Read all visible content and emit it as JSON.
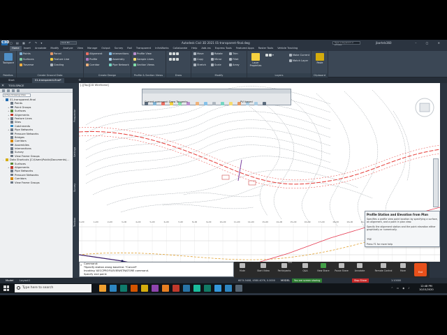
{
  "app": {
    "title": "Autodesk Civil 3D 2021   01-transparent-final.dwg",
    "search_placeholder": "Type a keyword or phrase",
    "user": "jbartels360",
    "workspace": "Civil 3D",
    "logo": "C3D"
  },
  "ribbon_tabs": [
    "Home",
    "Insert",
    "Annotate",
    "Modify",
    "Analyze",
    "View",
    "Manage",
    "Output",
    "Survey",
    "Rail",
    "Transparent",
    "InfraWorks",
    "Collaborate",
    "Help",
    "Add-ins",
    "Express Tools",
    "Featured Apps",
    "Raster Tools",
    "Vehicle Tracking"
  ],
  "active_tab": "Home",
  "ribbon": {
    "palettes": {
      "label": "Palettes",
      "button": "Toolspace"
    },
    "ground_data": {
      "label": "Create Ground Data",
      "items": [
        "Points",
        "Surfaces",
        "Traverse",
        "Parcel",
        "Feature Line",
        "Grading"
      ]
    },
    "design": {
      "label": "Create Design",
      "items": [
        "Alignment",
        "Profile",
        "Corridor",
        "Intersections",
        "Assembly",
        "Pipe Network"
      ]
    },
    "profile_section": {
      "label": "Profile & Section Views",
      "items": [
        "Profile View",
        "Sample Lines",
        "Section Views"
      ]
    },
    "draw": {
      "label": "Draw"
    },
    "modify": {
      "label": "Modify",
      "items": [
        "Move",
        "Copy",
        "Stretch",
        "Rotate",
        "Mirror",
        "Scale",
        "Trim",
        "Fillet",
        "Array"
      ]
    },
    "layers": {
      "label": "Layers",
      "button": "Layer Properties",
      "items": [
        "Make Current",
        "Match Layer"
      ]
    },
    "clipboard": {
      "label": "Clipboard",
      "button": "Paste"
    }
  },
  "doc_tabs": [
    "Start",
    "01-transparent-final*"
  ],
  "toolspace": {
    "title": "TOOLSPACE",
    "view_select": "Active Drawing View",
    "side_tabs": [
      "Prospector",
      "Settings",
      "Survey",
      "Toolbox"
    ],
    "tree": [
      {
        "label": "01-transparent-final",
        "level": 0,
        "icon_color": "#1f6ab0",
        "expand": "-"
      },
      {
        "label": "Points",
        "level": 1,
        "icon_color": "#6b7785",
        "expand": ""
      },
      {
        "label": "Point Groups",
        "level": 1,
        "icon_color": "#6b7785",
        "expand": "+"
      },
      {
        "label": "Surfaces",
        "level": 1,
        "icon_color": "#5a8a3a",
        "expand": "+"
      },
      {
        "label": "Alignments",
        "level": 1,
        "icon_color": "#c0392b",
        "expand": "+"
      },
      {
        "label": "Feature Lines",
        "level": 1,
        "icon_color": "#6b7785",
        "expand": "+"
      },
      {
        "label": "Sites",
        "level": 1,
        "icon_color": "#6b7785",
        "expand": ""
      },
      {
        "label": "Catchments",
        "level": 1,
        "icon_color": "#2e86c1",
        "expand": ""
      },
      {
        "label": "Pipe Networks",
        "level": 1,
        "icon_color": "#6b7785",
        "expand": "+"
      },
      {
        "label": "Pressure Networks",
        "level": 1,
        "icon_color": "#6b7785",
        "expand": ""
      },
      {
        "label": "Bridges",
        "level": 1,
        "icon_color": "#6b7785",
        "expand": ""
      },
      {
        "label": "Corridors",
        "level": 1,
        "icon_color": "#d68910",
        "expand": ""
      },
      {
        "label": "Assemblies",
        "level": 1,
        "icon_color": "#6b7785",
        "expand": ""
      },
      {
        "label": "Intersections",
        "level": 1,
        "icon_color": "#6b7785",
        "expand": ""
      },
      {
        "label": "Survey",
        "level": 1,
        "icon_color": "#6b7785",
        "expand": ""
      },
      {
        "label": "View Frame Groups",
        "level": 1,
        "icon_color": "#6b7785",
        "expand": ""
      },
      {
        "label": "Data Shortcuts [C:\\Users\\Public\\Documents\\...",
        "level": 0,
        "icon_color": "#d4ac0d",
        "expand": "-"
      },
      {
        "label": "Surfaces",
        "level": 1,
        "icon_color": "#5a8a3a",
        "expand": ""
      },
      {
        "label": "Alignments",
        "level": 1,
        "icon_color": "#c0392b",
        "expand": "+"
      },
      {
        "label": "Pipe Networks",
        "level": 1,
        "icon_color": "#6b7785",
        "expand": ""
      },
      {
        "label": "Pressure Networks",
        "level": 1,
        "icon_color": "#6b7785",
        "expand": ""
      },
      {
        "label": "Corridors",
        "level": 1,
        "icon_color": "#d68910",
        "expand": ""
      },
      {
        "label": "View Frame Groups",
        "level": 1,
        "icon_color": "#6b7785",
        "expand": ""
      }
    ]
  },
  "drawing": {
    "view_label": "[-][Top][2D Wireframe]",
    "floating_toolbar": {
      "command_label": "Current command: Draw Tangents",
      "pvi_label": "PVI based"
    },
    "profile_ticks": [
      "0+00",
      "1+00",
      "2+00",
      "3+00",
      "4+00",
      "5+00",
      "6+00",
      "7+00",
      "8+00",
      "9+00",
      "10+00",
      "11+00",
      "12+00",
      "13+00",
      "14+00",
      "15+00",
      "16+00",
      "17+00",
      "18+00",
      "19+00",
      "20+00",
      "21+00",
      "22+00",
      "23+00",
      "24+00",
      "25+00"
    ]
  },
  "tooltip": {
    "title": "Profile Station and Elevation from Plan",
    "desc1": "Specifies a profile view point location by specifying a surface, an alignment, and a point in plan view.",
    "desc2": "Specify the alignment station and the point elevation either graphically or numerically.",
    "key": "'PSE",
    "f1": "Press F1 for more help"
  },
  "command_line": {
    "lines": [
      "Command:",
      "*Specify station along baseline: *Cancel*",
      "Invoking 'AECCPROFILEVIEWSTNATORE command.",
      "Specify end point:"
    ],
    "close_icon": "x"
  },
  "zoom_bar": {
    "items": [
      "Mute",
      "Start Video",
      "Participants",
      "Q&A",
      "New Share",
      "Pause Share",
      "Annotate",
      "Remote Control",
      "More"
    ],
    "participants_count": "115",
    "end": "End"
  },
  "status_bar": {
    "tabs": [
      "Model",
      "Layout1"
    ],
    "coords": "6074.5408, 4580.4076, 0.0000",
    "model": "MODEL",
    "sharing": "You are screen sharing",
    "stop_share": "Stop Share",
    "scale": "1:10000"
  },
  "taskbar": {
    "search_placeholder": "Type here to search",
    "time": "12:48 PM",
    "date": "10/15/2020",
    "apps": [
      "#f0a030",
      "#2e86c1",
      "#0f7b6c",
      "#d35400",
      "#d4ac0d",
      "#8e44ad",
      "#e67e22",
      "#c0392b",
      "#2874a6",
      "#1abc9c",
      "#117a65",
      "#3498db",
      "#2e86c1",
      "#566573"
    ]
  }
}
